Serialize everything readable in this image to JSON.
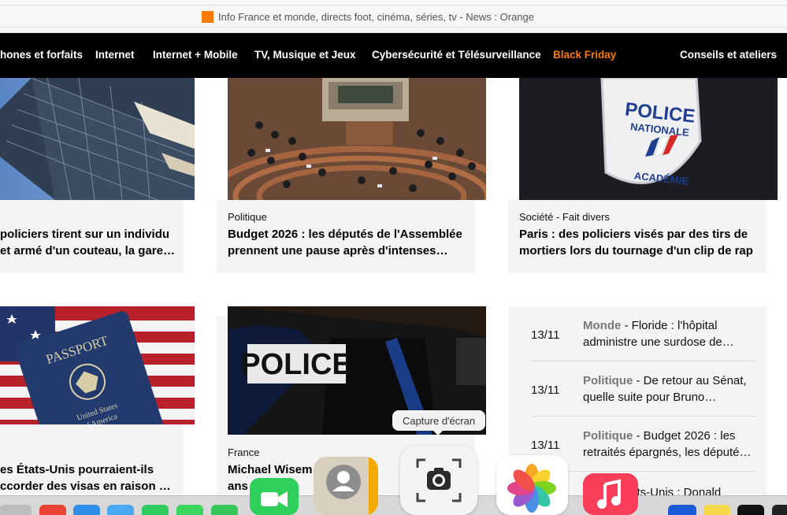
{
  "browser": {
    "tab_title": "Info France et monde, directs foot, cinéma, séries, tv - News : Orange",
    "favicon_color": "#ff7900"
  },
  "nav": {
    "items": [
      {
        "label": "hones et forfaits"
      },
      {
        "label": "Internet"
      },
      {
        "label": "Internet + Mobile"
      },
      {
        "label": "TV, Musique et Jeux"
      },
      {
        "label": "Cybersécurité et Télésurveillance"
      },
      {
        "label": "Black Friday",
        "accent": "#ff7900"
      },
      {
        "label": "Conseils et ateliers"
      }
    ]
  },
  "articles": [
    {
      "category": "",
      "title_line1": "policiers tirent sur un individu",
      "title_line2": "et armé d'un couteau, la gare…"
    },
    {
      "category": "Politique",
      "title_line1": "Budget 2026 : les députés de l'Assemblée",
      "title_line2": "prennent une pause après d'intenses…"
    },
    {
      "category": "Société - Fait divers",
      "title_line1": "Paris : des policiers visés par des tirs de",
      "title_line2": "mortiers lors du tournage d'un clip de rap"
    },
    {
      "category": "",
      "title_line1": "es États-Unis pourraient-ils",
      "title_line2": "ccorder des visas en raison …"
    },
    {
      "category": "France",
      "title_line1": "Michael Wisem",
      "title_line2": "ans"
    }
  ],
  "images": {
    "police_patch": {
      "line1": "POLICE",
      "line2": "NATIONALE",
      "line3": "ACADÉMIE"
    },
    "passport": {
      "title": "PASSPORT",
      "sub1": "United States",
      "sub2": "of America"
    },
    "police_back": {
      "text": "POLICE"
    }
  },
  "news_list": [
    {
      "date": "13/11",
      "category": "Monde",
      "text": " - Floride : l'hôpital administre une surdose de…"
    },
    {
      "date": "13/11",
      "category": "Politique",
      "text": " - De retour au Sénat, quelle suite pour Bruno…"
    },
    {
      "date": "13/11",
      "category": "Politique",
      "text": " - Budget 2026 : les retraités épargnés, les député…"
    },
    {
      "date": "",
      "category": "",
      "text": "États-Unis : Donald"
    }
  ],
  "dock": {
    "tooltip": "Capture d'écran",
    "icons": [
      "facetime-icon",
      "contacts-icon",
      "screenshot-icon",
      "photos-icon",
      "music-icon"
    ]
  }
}
